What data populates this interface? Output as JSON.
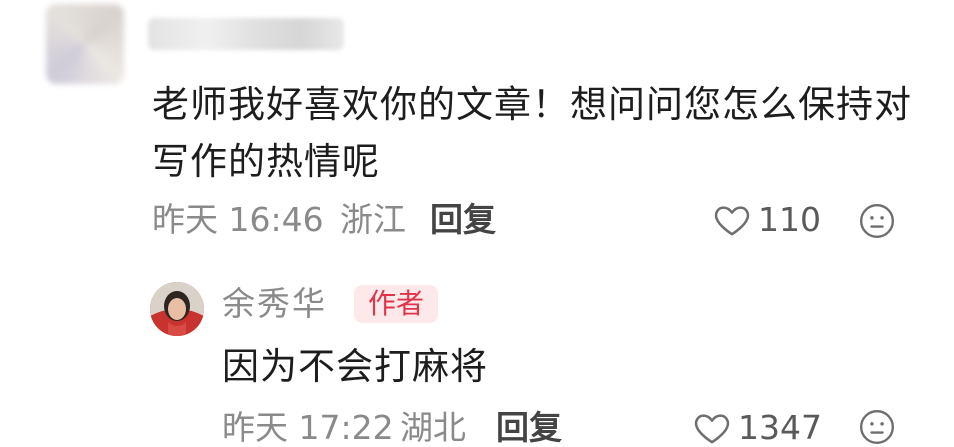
{
  "comment": {
    "text": "老师我好喜欢你的文章！想问问您怎么保持对写作的热情呢",
    "time": "昨天 16:46",
    "location": "浙江",
    "reply_label": "回复",
    "likes": "110"
  },
  "reply": {
    "author": "余秀华",
    "badge": "作者",
    "text": "因为不会打麻将",
    "time": "昨天 17:22",
    "location": "湖北",
    "reply_label": "回复",
    "likes": "1347"
  },
  "colors": {
    "badge_text": "#e0344b",
    "badge_bg": "#fde8ea",
    "meta_gray": "#8a8a8a"
  },
  "icons": [
    "heart-outline-icon",
    "emoji-face-icon"
  ]
}
